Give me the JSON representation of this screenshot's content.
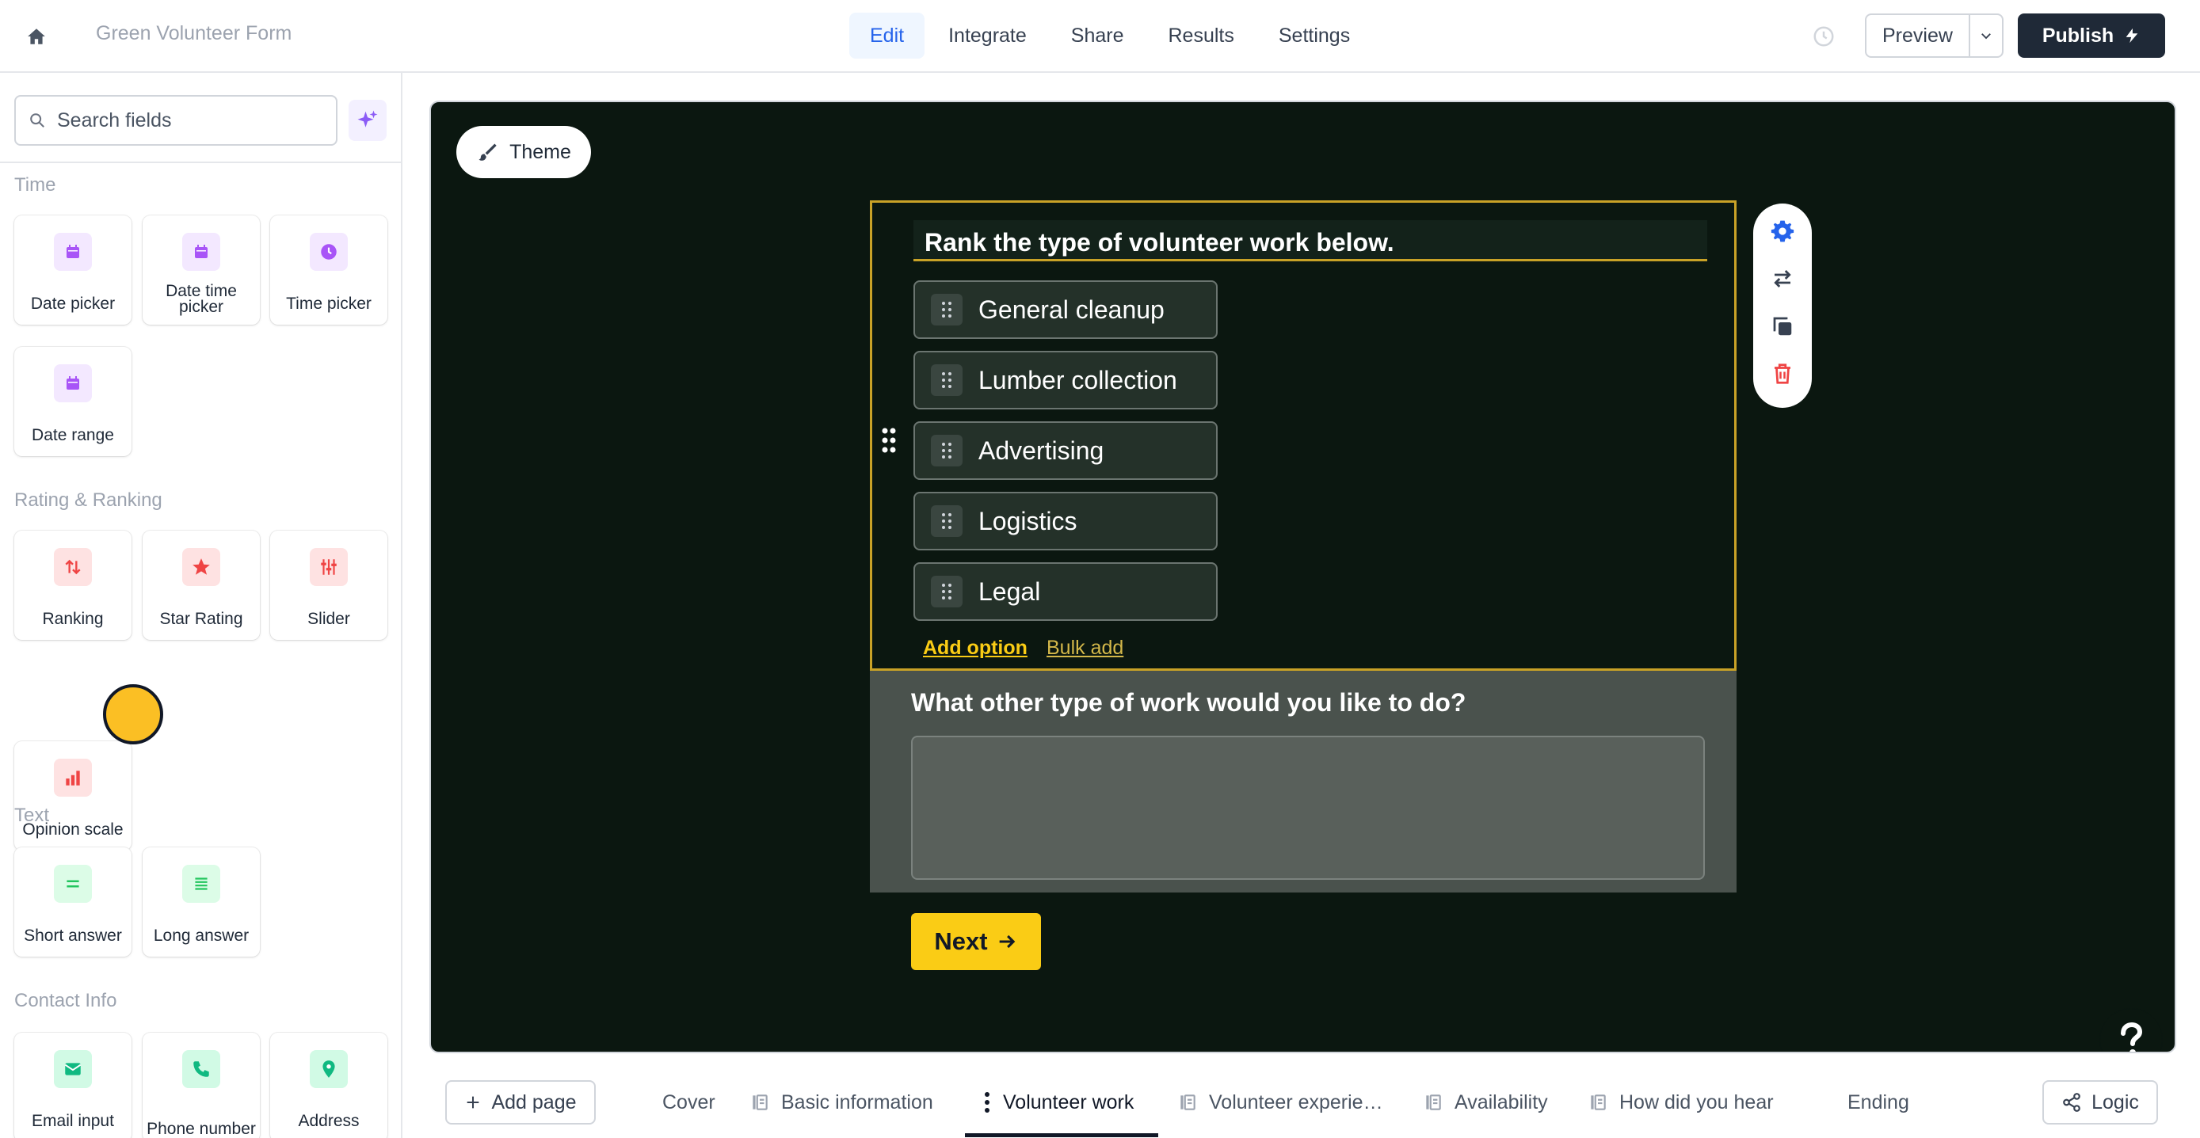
{
  "header": {
    "form_title": "Green Volunteer Form",
    "tabs": [
      {
        "label": "Edit",
        "active": true
      },
      {
        "label": "Integrate",
        "active": false
      },
      {
        "label": "Share",
        "active": false
      },
      {
        "label": "Results",
        "active": false
      },
      {
        "label": "Settings",
        "active": false
      }
    ],
    "preview_label": "Preview",
    "publish_label": "Publish"
  },
  "sidebar": {
    "search_placeholder": "Search fields",
    "sections": {
      "time": {
        "title": "Time",
        "items": [
          "Date picker",
          "Date time picker",
          "Time picker",
          "Date range"
        ]
      },
      "rating": {
        "title": "Rating & Ranking",
        "items": [
          "Ranking",
          "Star Rating",
          "Slider",
          "Opinion scale"
        ]
      },
      "text": {
        "title": "Text",
        "items": [
          "Short answer",
          "Long answer"
        ]
      },
      "contact": {
        "title": "Contact Info",
        "items": [
          "Email input",
          "Phone number",
          "Address"
        ]
      }
    }
  },
  "canvas": {
    "theme_label": "Theme",
    "question1": {
      "title": "Rank the type of volunteer work below.",
      "options": [
        "General cleanup",
        "Lumber collection",
        "Advertising",
        "Logistics",
        "Legal"
      ],
      "add_option_label": "Add option",
      "bulk_add_label": "Bulk add"
    },
    "question2": {
      "title": "What other type of work would you like to do?",
      "answer": ""
    },
    "next_label": "Next"
  },
  "pagebar": {
    "add_page_label": "Add page",
    "pages": [
      {
        "label": "Cover",
        "active": false
      },
      {
        "label": "Basic information",
        "active": false
      },
      {
        "label": "Volunteer work",
        "active": true
      },
      {
        "label": "Volunteer experie…",
        "active": false
      },
      {
        "label": "Availability",
        "active": false
      },
      {
        "label": "How did you hear",
        "active": false
      },
      {
        "label": "Ending",
        "active": false
      }
    ],
    "logic_label": "Logic"
  },
  "colors": {
    "accent_blue": "#2563eb",
    "canvas_bg": "#0b1710",
    "selection_gold": "#c9a227",
    "next_yellow": "#facc15",
    "publish_dark": "#1f2937"
  },
  "icons": {
    "home": "home-icon",
    "history": "clock-icon",
    "search": "search-icon",
    "ai": "sparkles-icon",
    "settings": "gear-icon",
    "swap": "swap-arrows-icon",
    "duplicate": "copy-icon",
    "delete": "trash-icon",
    "help": "question-icon",
    "logic": "share-nodes-icon"
  }
}
